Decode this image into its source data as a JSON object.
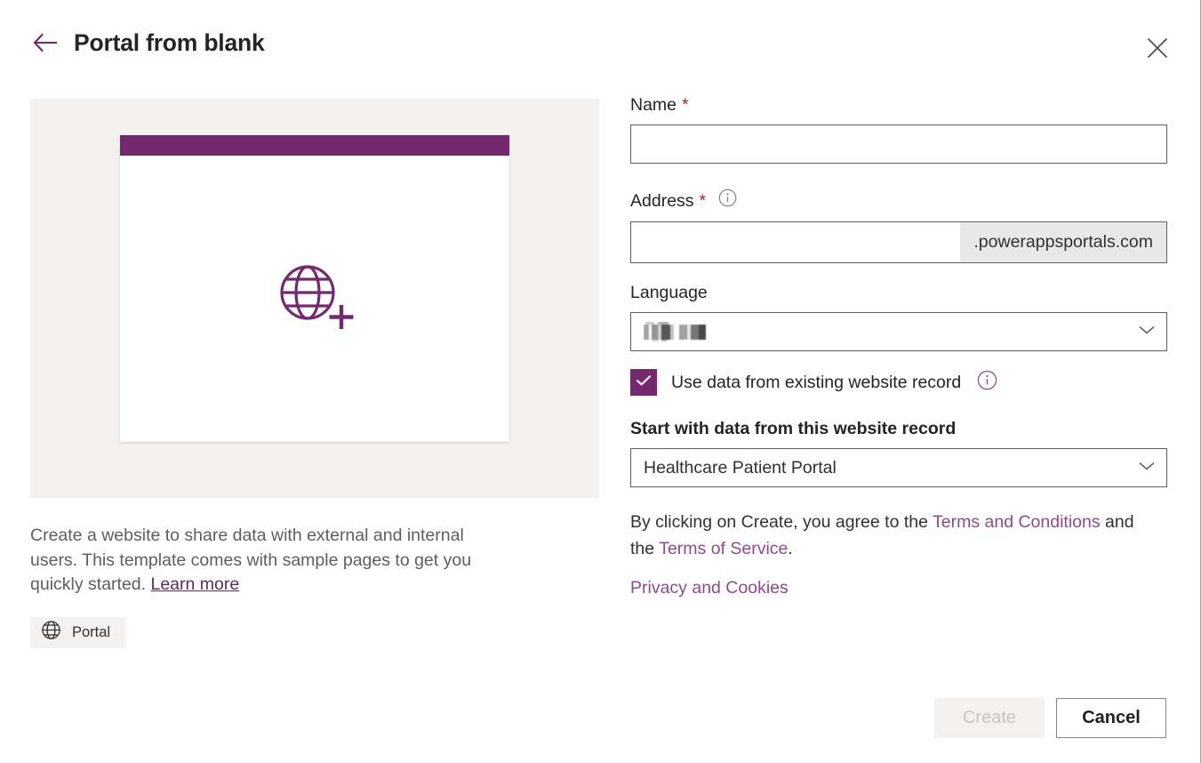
{
  "header": {
    "title": "Portal from blank",
    "back_icon": "arrow-left-icon",
    "close_icon": "close-icon"
  },
  "preview": {
    "illustration_icon": "globe-plus-icon",
    "card_bar_color": "#76286f",
    "panel_bg_color": "#f3f2f1",
    "description": "Create a website to share data with external and internal users. This template comes with sample pages to get you quickly started.",
    "learn_more_label": "Learn more",
    "tag": {
      "icon": "globe-icon",
      "label": "Portal"
    }
  },
  "form": {
    "name": {
      "label": "Name",
      "required_marker": "*",
      "value": "",
      "placeholder": ""
    },
    "address": {
      "label": "Address",
      "required_marker": "*",
      "info_icon": "info-icon",
      "value": "",
      "placeholder": "",
      "suffix": ".powerappsportals.com"
    },
    "language": {
      "label": "Language",
      "value": "",
      "redacted": true,
      "chevron_icon": "chevron-down-icon"
    },
    "use_existing_record": {
      "label": "Use data from existing website record",
      "checked": true,
      "check_icon": "check-icon",
      "info_icon": "info-icon",
      "accent_color": "#76286f"
    },
    "website_record": {
      "label": "Start with data from this website record",
      "value": "Healthcare Patient Portal",
      "chevron_icon": "chevron-down-icon"
    }
  },
  "legal": {
    "intro": "By clicking on Create, you agree to the ",
    "terms_conditions_label": "Terms and Conditions",
    "middle": " and the ",
    "terms_of_service_label": "Terms of Service",
    "period": ".",
    "privacy_label": "Privacy and Cookies",
    "link_color": "#8d4a8d"
  },
  "footer": {
    "create_label": "Create",
    "create_disabled": true,
    "cancel_label": "Cancel"
  }
}
